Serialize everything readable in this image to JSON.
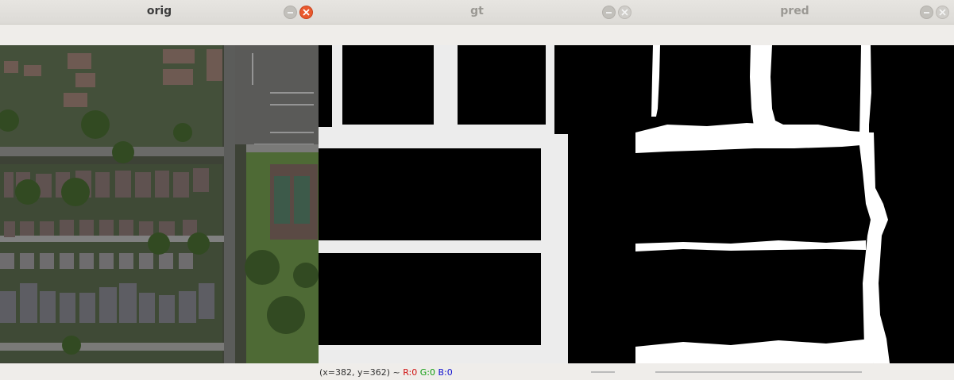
{
  "windows": [
    {
      "title": "orig",
      "active": true
    },
    {
      "title": "gt",
      "active": false
    },
    {
      "title": "pred",
      "active": false
    }
  ],
  "status": {
    "coords": "(x=382, y=362) ~",
    "r_label": "R:0",
    "g_label": "G:0",
    "b_label": "B:0"
  },
  "icons": {
    "minimize": "minimize-icon",
    "close": "close-icon"
  },
  "colors": {
    "close_active": "#e9592e",
    "mask_road": "#ececec",
    "pred_road": "#ffffff"
  }
}
